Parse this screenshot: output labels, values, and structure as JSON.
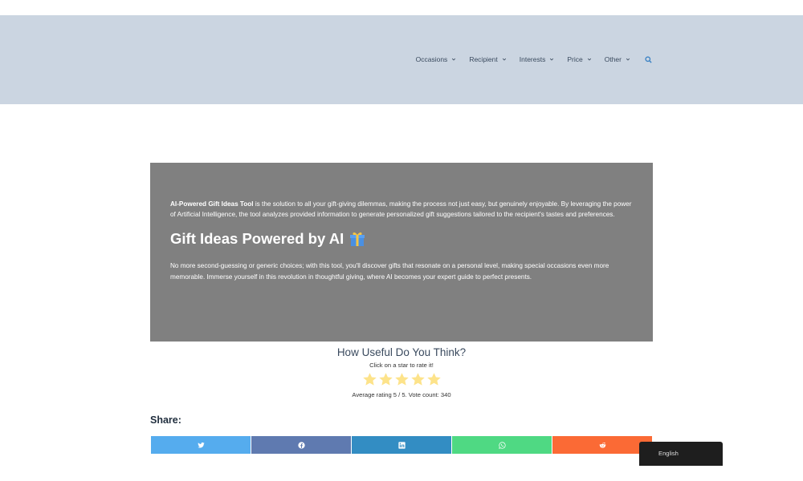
{
  "nav": {
    "items": [
      {
        "label": "Occasions"
      },
      {
        "label": "Recipient"
      },
      {
        "label": "Interests"
      },
      {
        "label": "Price"
      },
      {
        "label": "Other"
      }
    ],
    "search_icon": "search-icon"
  },
  "hero": {
    "intro_bold": "AI-Powered Gift Ideas Tool",
    "intro_rest": " is the solution to all your gift-giving dilemmas, making the process not just easy, but genuinely enjoyable. By leveraging the power of Artificial Intelligence, the tool analyzes provided information to generate personalized gift suggestions tailored to the recipient's tastes and preferences.",
    "heading": "Gift Ideas Powered by AI",
    "heading_icon": "gift-icon",
    "body": "No more second-guessing or generic choices; with this tool, you'll discover gifts that resonate on a personal level, making special occasions even more memorable. Immerse yourself in this revolution in thoughtful giving, where AI becomes your expert guide to perfect presents."
  },
  "rating": {
    "title": "How Useful Do You Think?",
    "subtitle": "Click on a star to rate it!",
    "stars_filled": 5,
    "stars_total": 5,
    "average_text": "Average rating 5 / 5. Vote count: 340"
  },
  "share": {
    "label": "Share:",
    "buttons": [
      {
        "network": "twitter",
        "icon": "twitter-icon",
        "color": "#55acee"
      },
      {
        "network": "facebook",
        "icon": "facebook-icon",
        "color": "#5f7ab0"
      },
      {
        "network": "linkedin",
        "icon": "linkedin-icon",
        "color": "#338dc3"
      },
      {
        "network": "whatsapp",
        "icon": "whatsapp-icon",
        "color": "#4fd983"
      },
      {
        "network": "reddit",
        "icon": "reddit-icon",
        "color": "#fb6a35"
      }
    ]
  },
  "language": {
    "label": "English"
  },
  "colors": {
    "header_bg": "#cbd5e1",
    "hero_bg": "#808080",
    "star": "#fde38a",
    "search_icon": "#3b82c4"
  }
}
